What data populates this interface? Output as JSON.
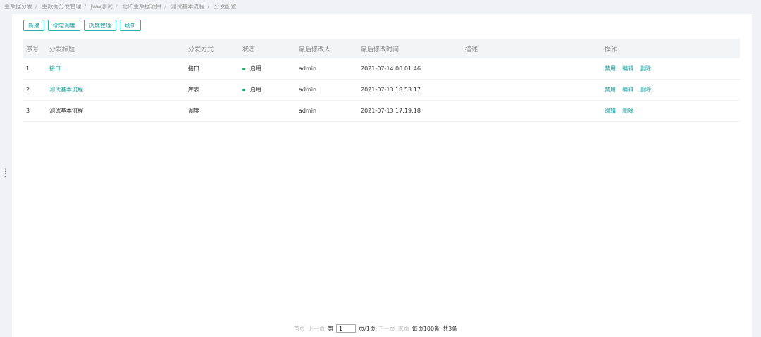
{
  "breadcrumb": [
    "主数据分发",
    "主数据分发管理",
    "jww测试",
    "北矿主数据项目",
    "测试基本流程",
    "分发配置"
  ],
  "toolbar": {
    "new_label": "新建",
    "bind_label": "绑定调度",
    "schedule_label": "调度管理",
    "refresh_label": "刷新"
  },
  "table": {
    "headers": [
      "序号",
      "分发标题",
      "分发方式",
      "状态",
      "最后修改人",
      "最后修改时间",
      "描述",
      "操作"
    ],
    "rows": [
      {
        "index": "1",
        "title": "接口",
        "method": "接口",
        "status": "启用",
        "modifier": "admin",
        "time": "2021-07-14 00:01:46",
        "desc": "",
        "ops": [
          "禁用",
          "编辑",
          "删除"
        ]
      },
      {
        "index": "2",
        "title": "测试基本流程",
        "method": "库表",
        "status": "启用",
        "modifier": "admin",
        "time": "2021-07-13 18:53:17",
        "desc": "",
        "ops": [
          "禁用",
          "编辑",
          "删除"
        ]
      },
      {
        "index": "3",
        "title": "测试基本流程",
        "method": "调度",
        "status": "",
        "modifier": "admin",
        "time": "2021-07-13 17:19:18",
        "desc": "",
        "ops": [
          "编辑",
          "删除"
        ]
      }
    ]
  },
  "pager": {
    "first": "首页",
    "prev": "上一页",
    "page_prefix": "第",
    "page_value": "1",
    "page_suffix": "页/1页",
    "next": "下一页",
    "last": "末页",
    "per_page": "每页100条",
    "total": "共3条"
  },
  "colors": {
    "accent": "#1aa3a0",
    "status_on": "#19be6b"
  }
}
